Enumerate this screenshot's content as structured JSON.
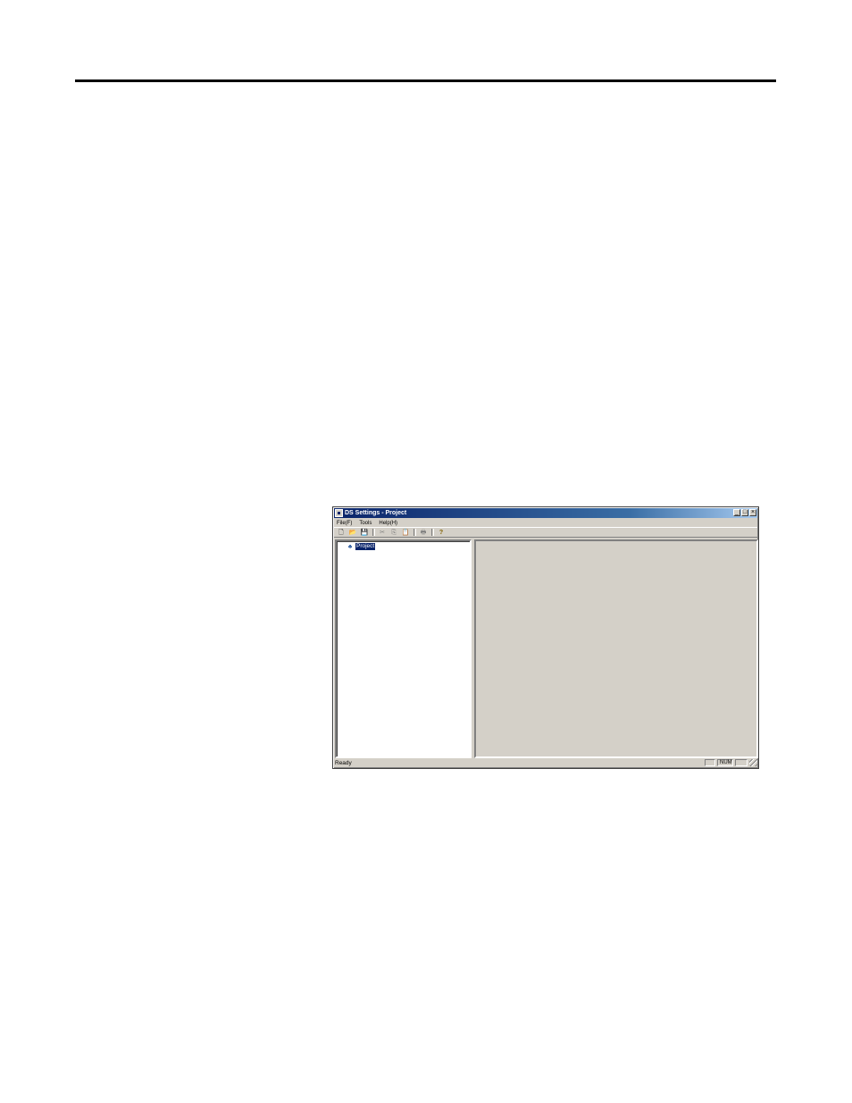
{
  "window": {
    "title": "DS Settings - Project",
    "caption_buttons": {
      "minimize": "_",
      "maximize": "□",
      "close": "×"
    }
  },
  "menubar": {
    "items": [
      "File(F)",
      "Tools",
      "Help(H)"
    ]
  },
  "toolbar": {
    "buttons": {
      "new": "🗋",
      "open": "📂",
      "save": "💾",
      "cut": "✂",
      "copy": "⎘",
      "paste": "📋",
      "print": "🖶",
      "help": "?"
    },
    "icons": [
      "new-file-icon",
      "open-folder-icon",
      "save-icon",
      "cut-icon",
      "copy-icon",
      "paste-icon",
      "print-icon",
      "help-icon"
    ]
  },
  "tree": {
    "root_icon": "♣",
    "root_label": "Project"
  },
  "statusbar": {
    "text": "Ready",
    "num_indicator": "NUM"
  },
  "colors": {
    "title_active": "#0a246a",
    "face": "#d4d0c8",
    "selection": "#0a246a"
  }
}
